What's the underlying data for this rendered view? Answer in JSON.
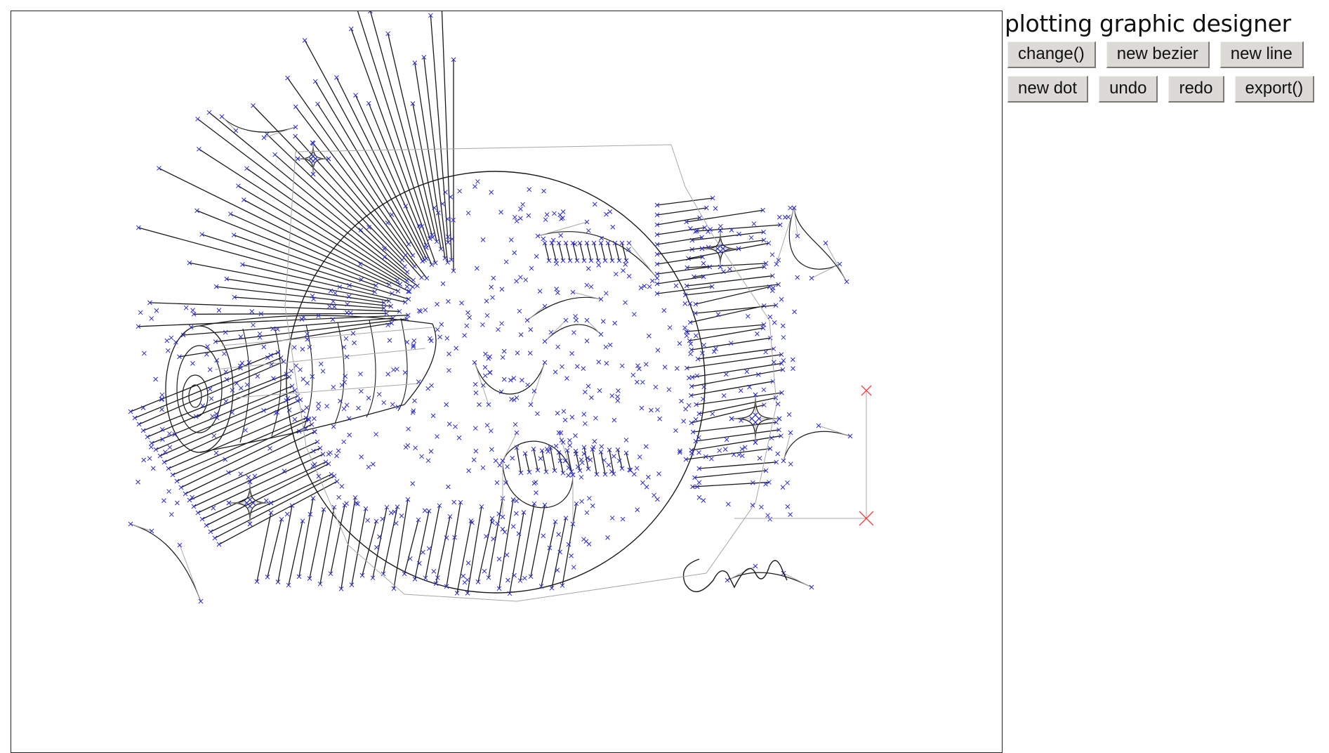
{
  "title": "plotting graphic designer",
  "toolbar": {
    "row1": [
      {
        "id": "change-button",
        "label": "change()"
      },
      {
        "id": "new-bezier-button",
        "label": "new bezier"
      },
      {
        "id": "new-line-button",
        "label": "new line"
      }
    ],
    "row2": [
      {
        "id": "new-dot-button",
        "label": "new dot"
      },
      {
        "id": "undo-button",
        "label": "undo"
      },
      {
        "id": "redo-button",
        "label": "redo"
      },
      {
        "id": "export-button",
        "label": "export()"
      }
    ]
  },
  "colors": {
    "stroke": "#1a1a1a",
    "control_line": "#a8a8a8",
    "control_point": "#2b2bd0",
    "selection": "#ff3b3b",
    "button_face": "#dcdad6"
  },
  "canvas": {
    "drawing": "line-art illustration: screaming face with a telescope, radiating speed lines, stars and a signature"
  }
}
